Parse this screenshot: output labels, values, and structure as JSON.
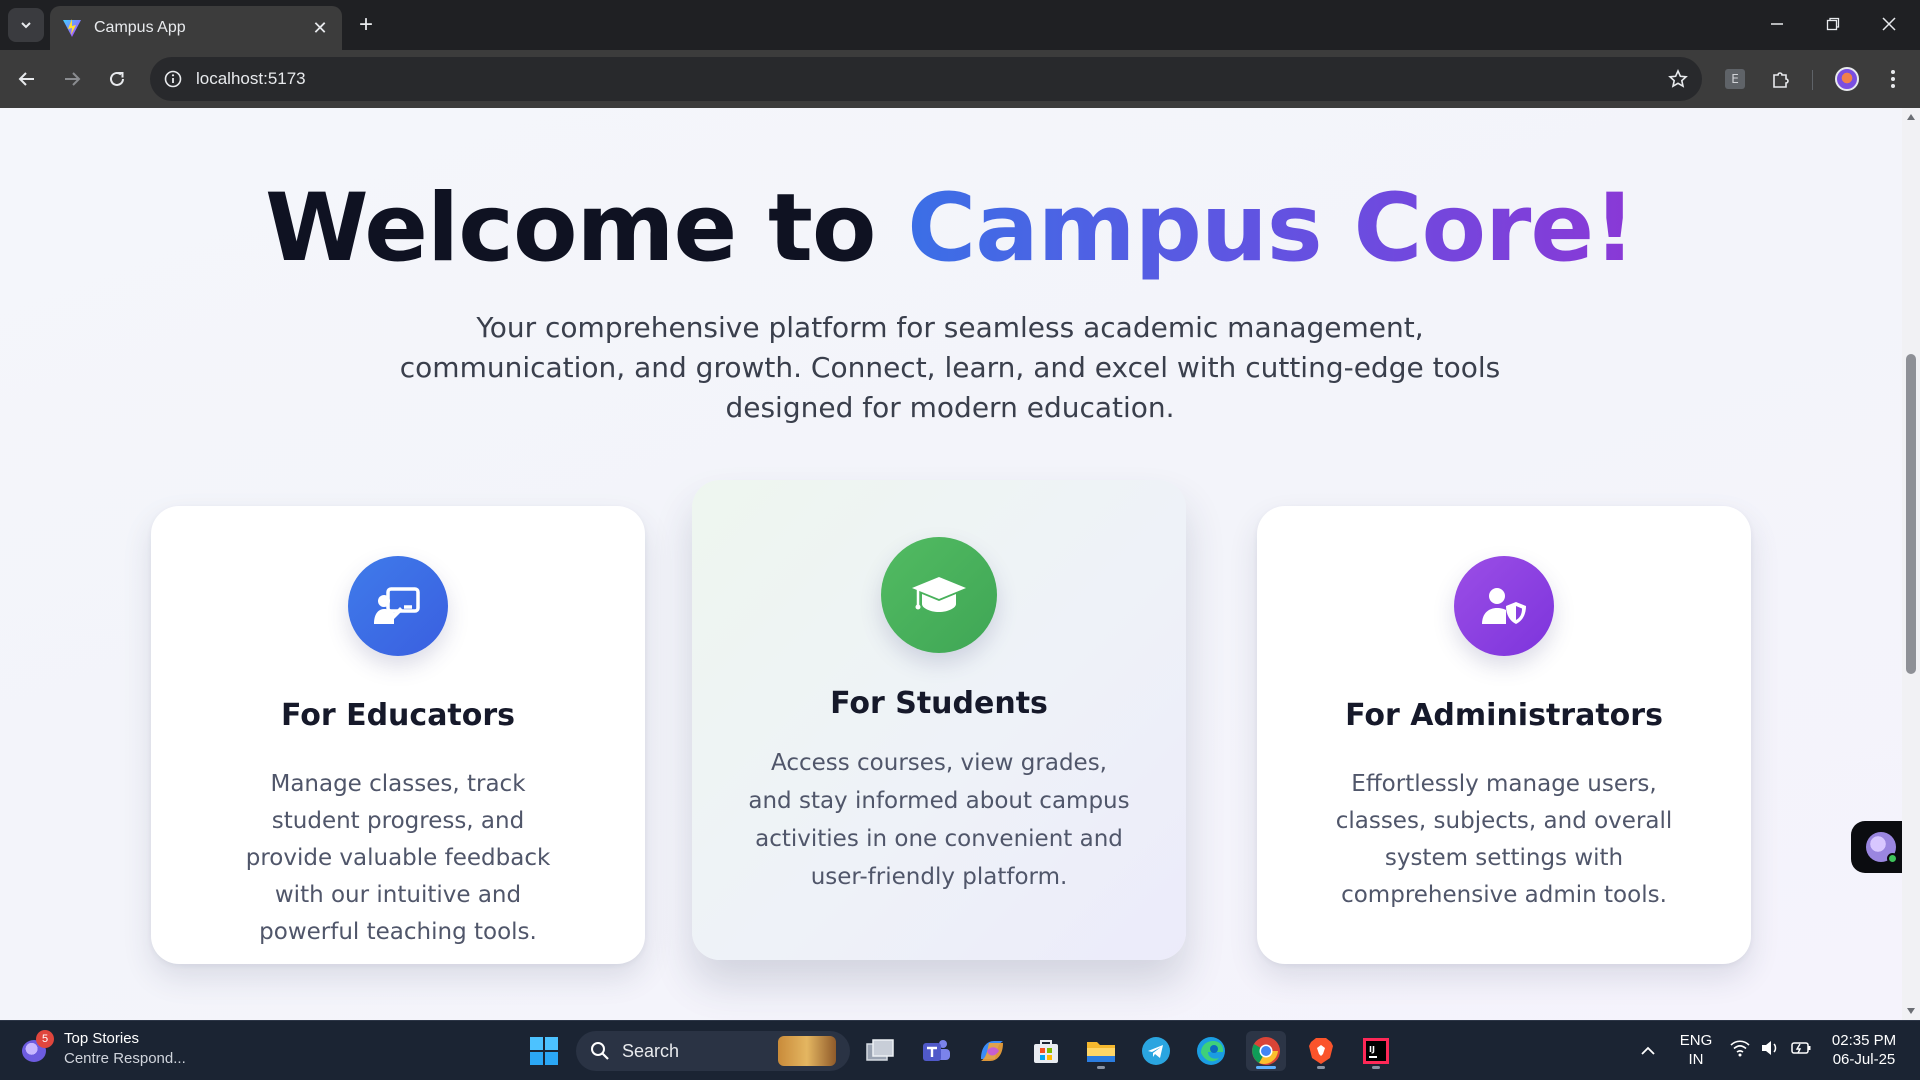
{
  "browser": {
    "tab_title": "Campus App",
    "tab_close": "✕",
    "new_tab": "+",
    "url": "localhost:5173"
  },
  "hero": {
    "title_main": "Welcome to ",
    "title_accent": "Campus Core!",
    "subtitle": "Your comprehensive platform for seamless academic management, communication, and growth. Connect, learn, and excel with cutting-edge tools designed for modern education."
  },
  "cards": [
    {
      "title": "For Educators",
      "text": "Manage classes, track student progress, and provide valuable feedback with our intuitive and powerful teaching tools.",
      "icon": "teacher-board-icon",
      "color": "#3b6fe6"
    },
    {
      "title": "For Students",
      "text": "Access courses, view grades, and stay informed about campus activities in one convenient and user-friendly platform.",
      "icon": "graduation-cap-icon",
      "color": "#3fae55"
    },
    {
      "title": "For Administrators",
      "text": "Effortlessly manage users, classes, subjects, and overall system settings with comprehensive admin tools.",
      "icon": "user-shield-icon",
      "color": "#8a3fe0"
    }
  ],
  "taskbar": {
    "news_count": "5",
    "news_title": "Top Stories",
    "news_sub": "Centre Respond...",
    "search_label": "Search",
    "lang_top": "ENG",
    "lang_bottom": "IN",
    "time": "02:35 PM",
    "date": "06-Jul-25"
  }
}
